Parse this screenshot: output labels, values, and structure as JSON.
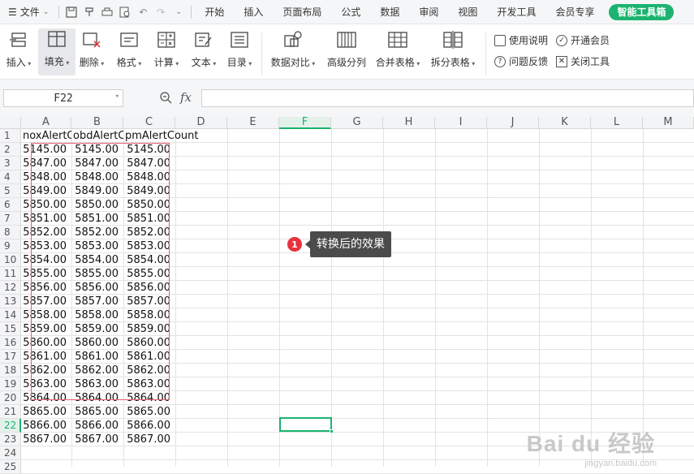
{
  "menu": {
    "file_label": "文件"
  },
  "tabs": [
    "开始",
    "插入",
    "页面布局",
    "公式",
    "数据",
    "审阅",
    "视图",
    "开发工具",
    "会员专享"
  ],
  "smart_tab": "智能工具箱",
  "ribbon": {
    "insert": "插入",
    "fill": "填充",
    "delete": "删除",
    "format": "格式",
    "calc": "计算",
    "text": "文本",
    "toc": "目录",
    "compare": "数据对比",
    "split_col": "高级分列",
    "merge_table": "合并表格",
    "split_table": "拆分表格",
    "help": "使用说明",
    "member": "开通会员",
    "feedback": "问题反馈",
    "close_tool": "关闭工具"
  },
  "formula_bar": {
    "cell_ref": "F22",
    "fx": "fx",
    "value": ""
  },
  "columns": [
    "A",
    "B",
    "C",
    "D",
    "E",
    "F",
    "G",
    "H",
    "I",
    "J",
    "K",
    "L",
    "M"
  ],
  "selected_column": "F",
  "selected_row": "22",
  "rows": [
    "1",
    "2",
    "3",
    "4",
    "5",
    "6",
    "7",
    "8",
    "9",
    "10",
    "11",
    "12",
    "13",
    "14",
    "15",
    "16",
    "17",
    "18",
    "19",
    "20",
    "21",
    "22",
    "23",
    "24",
    "25"
  ],
  "headers": [
    "noxAlertCo",
    "obdAlertCo",
    "pmAlertCount"
  ],
  "values": [
    "5145.00",
    "5847.00",
    "5848.00",
    "5849.00",
    "5850.00",
    "5851.00",
    "5852.00",
    "5853.00",
    "5854.00",
    "5855.00",
    "5856.00",
    "5857.00",
    "5858.00",
    "5859.00",
    "5860.00",
    "5861.00",
    "5862.00",
    "5863.00",
    "5864.00",
    "5865.00",
    "5866.00",
    "5867.00"
  ],
  "callout": {
    "number": "1",
    "text": "转换后的效果"
  },
  "watermark": {
    "main": "Bai du 经验",
    "sub": "jingyan.baidu.com"
  }
}
